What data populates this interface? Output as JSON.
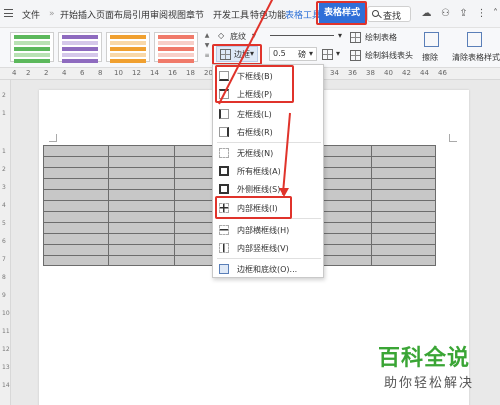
{
  "menubar": {
    "file_label": "文件",
    "tabs": [
      "开始",
      "插入",
      "页面布局",
      "引用",
      "审阅",
      "视图",
      "章节",
      "开发工具",
      "特色功能",
      "表格工具"
    ],
    "active_tab": "表格样式",
    "search_label": "查找"
  },
  "ribbon": {
    "shading_label": "底纹",
    "border_label": "边框",
    "line_width_value": "0.5",
    "line_width_unit": "磅",
    "draw_table_label": "绘制表格",
    "draw_diagonal_label": "绘制斜线表头",
    "erase_label": "擦除",
    "clear_style_label": "清除表格样式"
  },
  "ruler": {
    "numbers": [
      "4",
      "2",
      "2",
      "4",
      "6",
      "8",
      "10",
      "12",
      "14",
      "16",
      "18",
      "20",
      "22",
      "24",
      "26",
      "28",
      "30",
      "32",
      "34",
      "36",
      "38",
      "40",
      "42",
      "44",
      "46"
    ],
    "vertical_numbers": [
      "2",
      "1",
      "1",
      "2",
      "3",
      "4",
      "5",
      "6",
      "7",
      "8",
      "9",
      "10",
      "11",
      "12",
      "13",
      "14"
    ]
  },
  "border_menu": {
    "items": [
      "下框线(B)",
      "上框线(P)",
      "左框线(L)",
      "右框线(R)",
      "无框线(N)",
      "所有框线(A)",
      "外侧框线(S)",
      "内部框线(I)",
      "内部横框线(H)",
      "内部竖框线(V)",
      "边框和底纹(O)..."
    ]
  },
  "watermark": {
    "title": "百科全说",
    "subtitle": "助你轻松解决"
  },
  "colors": {
    "accent": "#2f6fd8",
    "highlight": "#e0332b",
    "table_fill": "#c7c7c7",
    "watermark_green": "#3aa535"
  }
}
